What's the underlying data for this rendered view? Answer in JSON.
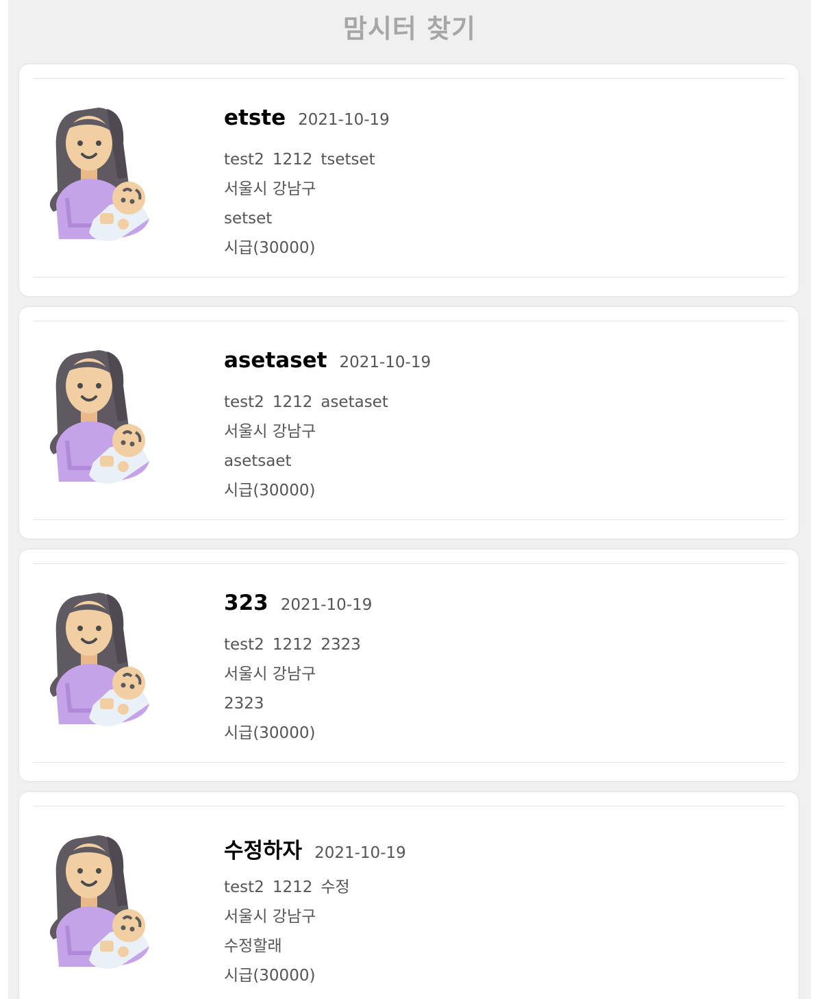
{
  "page": {
    "title": "맘시터 찾기"
  },
  "cards": [
    {
      "name": "etste",
      "date": "2021-10-19",
      "meta": [
        "test2",
        "1212",
        "tsetset"
      ],
      "location": "서울시 강남구",
      "description": "setset",
      "wage": "시급(30000)",
      "avatar_icon": "mother-holding-baby-icon"
    },
    {
      "name": "asetaset",
      "date": "2021-10-19",
      "meta": [
        "test2",
        "1212",
        "asetaset"
      ],
      "location": "서울시 강남구",
      "description": "asetsaet",
      "wage": "시급(30000)",
      "avatar_icon": "mother-holding-baby-icon"
    },
    {
      "name": "323",
      "date": "2021-10-19",
      "meta": [
        "test2",
        "1212",
        "2323"
      ],
      "location": "서울시 강남구",
      "description": "2323",
      "wage": "시급(30000)",
      "avatar_icon": "mother-holding-baby-icon"
    },
    {
      "name": "수정하자",
      "date": "2021-10-19",
      "meta": [
        "test2",
        "1212",
        "수정"
      ],
      "location": "서울시 강남구",
      "description": "수정할래",
      "wage": "시급(30000)",
      "avatar_icon": "mother-holding-baby-icon"
    }
  ],
  "colors": {
    "page_background": "#f0f0f0",
    "card_background": "#ffffff",
    "title_text": "#a6a6a6",
    "body_text": "#555555",
    "name_text": "#000000",
    "shirt_purple": "#c5a3e8",
    "hair_dark": "#5f5a62",
    "skin": "#f1cfa2"
  }
}
